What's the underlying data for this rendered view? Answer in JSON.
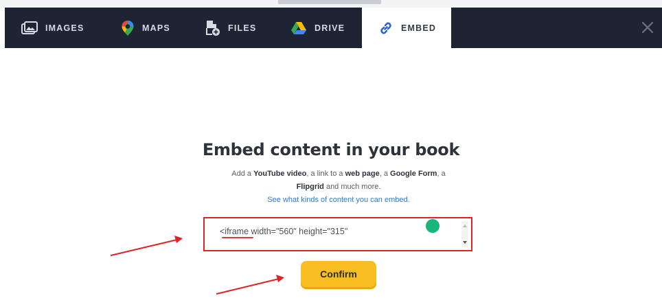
{
  "tabs": [
    {
      "label": "IMAGES",
      "icon": "images-icon"
    },
    {
      "label": "MAPS",
      "icon": "maps-pin-icon"
    },
    {
      "label": "FILES",
      "icon": "file-add-icon"
    },
    {
      "label": "DRIVE",
      "icon": "google-drive-icon"
    },
    {
      "label": "EMBED",
      "icon": "link-icon",
      "active": true
    }
  ],
  "close_icon": "close-icon",
  "main": {
    "title": "Embed content in your book",
    "desc_pre": "Add a ",
    "youtube": "YouTube video",
    "desc_mid1": ", a link to a ",
    "webpage": "web page",
    "desc_mid2": ", a ",
    "google_form": "Google Form",
    "desc_mid3": ", a ",
    "flipgrid": "Flipgrid",
    "desc_post": " and much more.",
    "link": "See what kinds of content you can embed."
  },
  "embed_input": {
    "value": "<iframe width=\"560\" height=\"315\""
  },
  "confirm_label": "Confirm",
  "colors": {
    "toolbar_bg": "#1d2433",
    "accent_yellow": "#f7bd21",
    "highlight_red": "#e02424",
    "link_blue": "#2a7ad8"
  }
}
